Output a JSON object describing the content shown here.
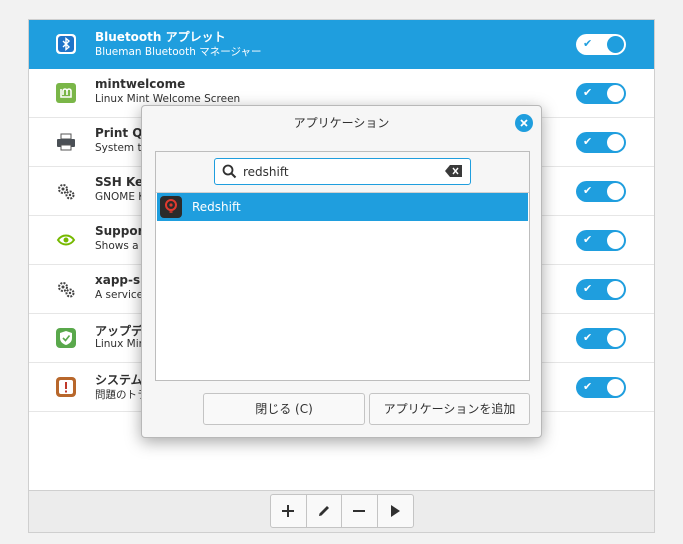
{
  "startup_apps": [
    {
      "name": "Bluetooth アプレット",
      "desc": "Blueman Bluetooth マネージャー",
      "icon": "bluetooth-icon",
      "enabled": true,
      "selected": true
    },
    {
      "name": "mintwelcome",
      "desc": "Linux Mint Welcome Screen",
      "icon": "mint-icon",
      "enabled": true
    },
    {
      "name": "Print Q",
      "desc": "System tr",
      "icon": "printer-icon",
      "enabled": true
    },
    {
      "name": "SSH Ke",
      "desc": "GNOME K",
      "icon": "gears-icon",
      "enabled": true
    },
    {
      "name": "Suppor",
      "desc": "Shows a t",
      "icon": "nvidia-icon",
      "enabled": true
    },
    {
      "name": "xapp-sn",
      "desc": "A service",
      "icon": "gears-icon",
      "enabled": true
    },
    {
      "name": "アップデ",
      "desc": "Linux Min",
      "icon": "shield-icon",
      "enabled": true
    },
    {
      "name": "システム",
      "desc": "問題のトラ",
      "icon": "warning-icon",
      "enabled": true
    }
  ],
  "toolbar": {
    "add_icon": "plus-icon",
    "edit_icon": "pencil-icon",
    "remove_icon": "minus-icon",
    "run_icon": "play-icon"
  },
  "dialog": {
    "title": "アプリケーション",
    "search_value": "redshift",
    "results": [
      {
        "label": "Redshift",
        "icon": "redshift-icon"
      }
    ],
    "close_button": "閉じる (C)",
    "add_button": "アプリケーションを追加"
  },
  "colors": {
    "accent": "#1f9ede",
    "background": "#f2f2f2"
  }
}
